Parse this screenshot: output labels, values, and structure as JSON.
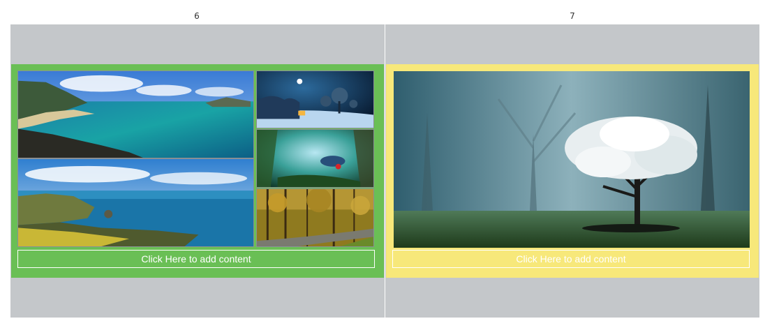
{
  "slides": [
    {
      "page_number": "6",
      "frame_color": "#6abf55",
      "button_label": "Click Here to add content",
      "photos": [
        "coastline-bay-photo",
        "coastline-cliffs-photo",
        "moonlit-night-photo",
        "fantasy-forest-photo",
        "autumn-forest-road-photo"
      ]
    },
    {
      "page_number": "7",
      "frame_color": "#f7e87a",
      "button_label": "Click Here to add content",
      "photos": [
        "misty-white-tree-photo"
      ]
    }
  ]
}
